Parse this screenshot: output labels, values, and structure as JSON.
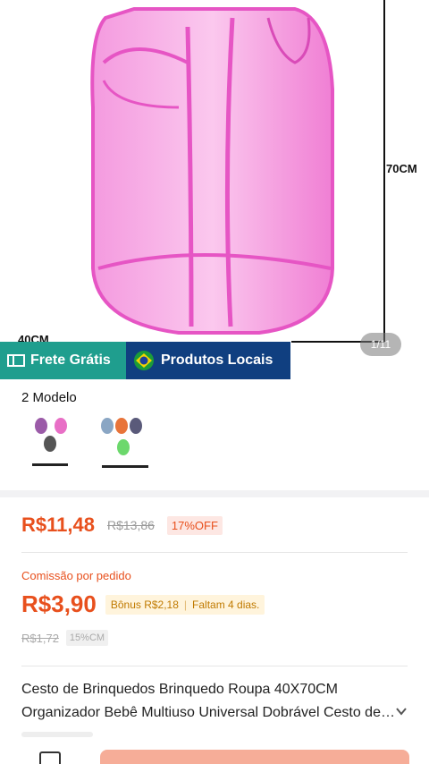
{
  "product_image": {
    "height_label": "70CM",
    "width_label": "40CM",
    "counter": "1/11"
  },
  "badges": {
    "free_shipping": "Frete Grátis",
    "local_products": "Produtos Locais"
  },
  "models": {
    "title": "2 Modelo",
    "items": [
      {
        "name": "model-1",
        "colors": [
          "#9b5ba8",
          "#e86fc6",
          "#555555"
        ]
      },
      {
        "name": "model-2",
        "colors": [
          "#8aa6c4",
          "#e8743a",
          "#5a5a7a",
          "#6cd86c"
        ]
      }
    ]
  },
  "price": {
    "current": "R$11,48",
    "original": "R$13,86",
    "discount": "17%OFF"
  },
  "commission": {
    "label": "Comissão por pedido",
    "value": "R$3,90",
    "bonus": "Bônus R$2,18",
    "remaining": "Faltam 4 dias.",
    "old_value": "R$1,72",
    "percent": "15%CM"
  },
  "product_title": "Cesto de Brinquedos Brinquedo Roupa 40X70CM Organizador Bebê Multiuso Universal Dobrável Cesto de Roupa",
  "colors": {
    "accent": "#e8501d",
    "free_shipping_bg": "#1f9e8e",
    "local_bg": "#103f80",
    "product_pink": "#f26fcf",
    "buy_button": "#f6ad98"
  }
}
